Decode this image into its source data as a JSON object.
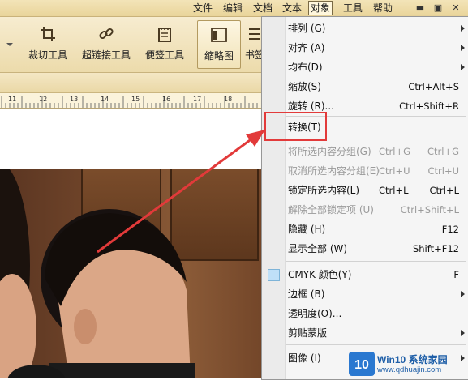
{
  "menubar": {
    "items": [
      "文件",
      "编辑",
      "文档",
      "文本",
      "对象",
      "工具",
      "帮助"
    ],
    "active": "对象"
  },
  "toolbar": {
    "buttons": [
      {
        "label": "裁切工具",
        "icon": "crop-icon"
      },
      {
        "label": "超链接工具",
        "icon": "link-icon"
      },
      {
        "label": "便签工具",
        "icon": "note-icon"
      },
      {
        "label": "缩略图",
        "icon": "thumbnail-icon",
        "selected": true
      },
      {
        "label": "书签",
        "icon": "bookmark-icon"
      }
    ]
  },
  "ruler": {
    "labels": [
      "11",
      "12",
      "13",
      "14",
      "15",
      "16",
      "17",
      "18"
    ]
  },
  "context_menu": {
    "items": [
      {
        "label": "排列 (G)",
        "submenu": true
      },
      {
        "label": "对齐 (A)",
        "submenu": true
      },
      {
        "label": "均布(D)",
        "submenu": true
      },
      {
        "label": "缩放(S)",
        "shortcut": "Ctrl+Alt+S"
      },
      {
        "label": "旋转 (R)...",
        "shortcut": "Ctrl+Shift+R"
      },
      {
        "label": "转换(T)",
        "highlighted": true
      },
      {
        "label": "将所选内容分组(G)",
        "shortcut_inline": "Ctrl+G",
        "shortcut": "Ctrl+G",
        "disabled": true
      },
      {
        "label": "取消所选内容分组(E)",
        "shortcut_inline": "Ctrl+U",
        "shortcut": "Ctrl+U",
        "disabled": true
      },
      {
        "label": "锁定所选内容(L)",
        "shortcut_inline": "Ctrl+L",
        "shortcut": "Ctrl+L"
      },
      {
        "label": "解除全部锁定项 (U)",
        "shortcut": "Ctrl+Shift+L",
        "disabled": true
      },
      {
        "label": "隐藏 (H)",
        "shortcut": "F12"
      },
      {
        "label": "显示全部 (W)",
        "shortcut": "Shift+F12"
      },
      {
        "label": "CMYK 颜色(Y)",
        "shortcut": "F",
        "checkbox": true
      },
      {
        "label": "边框 (B)",
        "submenu": true
      },
      {
        "label": "透明度(O)..."
      },
      {
        "label": "剪贴蒙版",
        "submenu": true
      },
      {
        "label": "图像 (I)",
        "submenu": true
      }
    ]
  },
  "watermark": {
    "brand": "Win10 系统家园",
    "url": "www.qdhuajin.com",
    "logo_text": "10"
  },
  "colors": {
    "highlight_box": "#e23a3a",
    "arrow": "#e23a3a"
  }
}
